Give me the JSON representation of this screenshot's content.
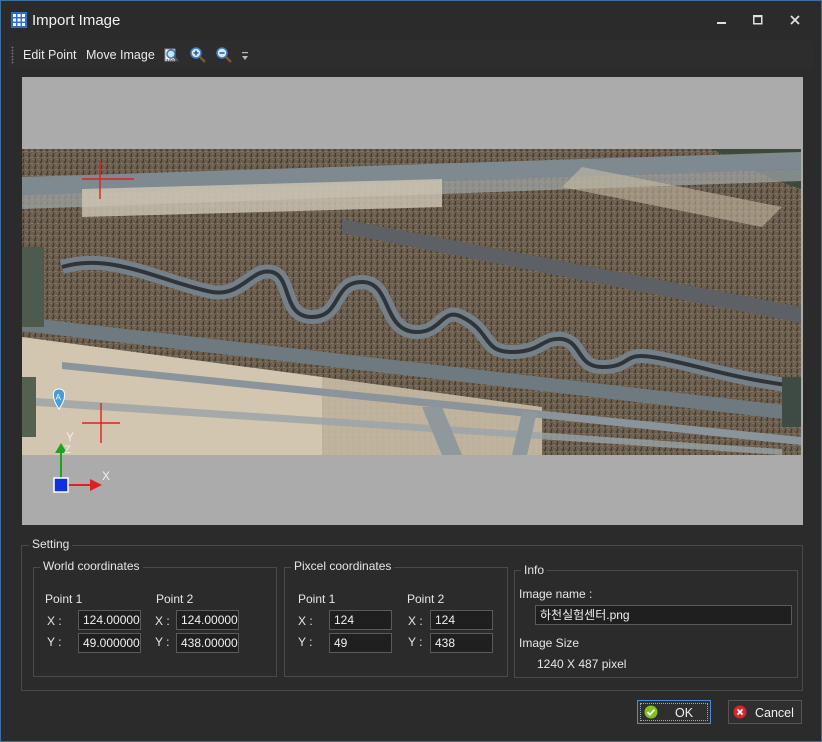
{
  "window": {
    "title": "Import Image"
  },
  "titlebar_buttons": [
    "minimize",
    "maximize",
    "close"
  ],
  "toolbar": {
    "edit_point": "Edit Point",
    "move_image": "Move Image",
    "icons": [
      "zoom-extents-icon",
      "zoom-in-icon",
      "zoom-out-icon",
      "overflow-icon"
    ]
  },
  "viewport": {
    "marker_label": "A",
    "axis_y": "Y",
    "axis_x": "X",
    "axis_z": "Z"
  },
  "setting": {
    "title": "Setting",
    "world": {
      "title": "World coordinates",
      "point1": {
        "label": "Point 1",
        "x_label": "X :",
        "y_label": "Y :",
        "x": "124.00000",
        "y": "49.000000"
      },
      "point2": {
        "label": "Point 2",
        "x_label": "X :",
        "y_label": "Y :",
        "x": "124.00000",
        "y": "438.00000"
      }
    },
    "pixel": {
      "title": "Pixcel coordinates",
      "point1": {
        "label": "Point 1",
        "x_label": "X :",
        "y_label": "Y :",
        "x": "124",
        "y": "49"
      },
      "point2": {
        "label": "Point 2",
        "x_label": "X :",
        "y_label": "Y :",
        "x": "124",
        "y": "438"
      }
    },
    "info": {
      "title": "Info",
      "image_name_label": "Image name :",
      "image_name": "하천실험센터.png",
      "image_size_label": "Image Size",
      "image_size": "1240 X 487 pixel"
    }
  },
  "buttons": {
    "ok": "OK",
    "cancel": "Cancel"
  },
  "colors": {
    "accent": "#4a8fd4",
    "ok_icon": "#7fc31c",
    "cancel_icon": "#d9262b",
    "axis_y": "#1fa31f",
    "axis_x": "#e02020",
    "axis_z": "#1030e0"
  }
}
